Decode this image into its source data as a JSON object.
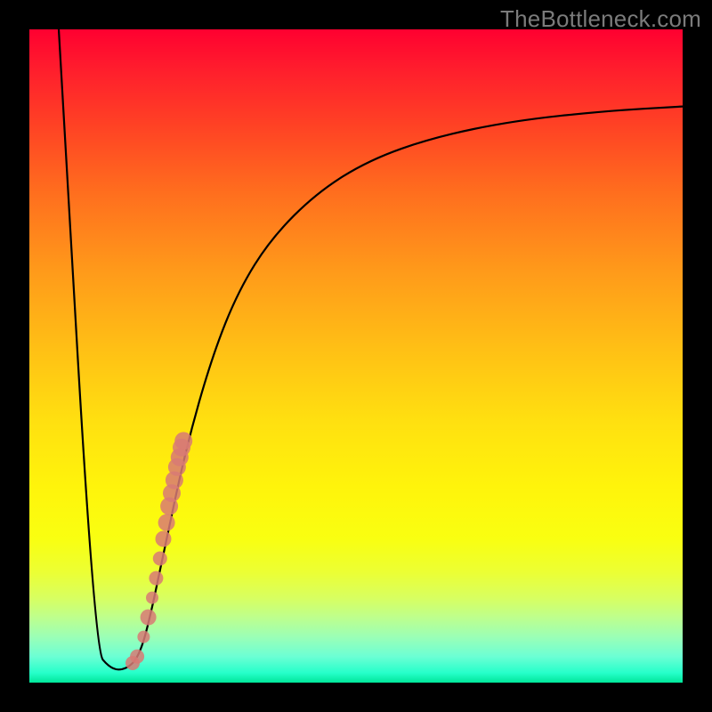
{
  "watermark": "TheBottleneck.com",
  "colors": {
    "frame": "#000000",
    "curve": "#000000",
    "marker_fill": "#d87a74",
    "marker_stroke": "#d87a74"
  },
  "chart_data": {
    "type": "line",
    "title": "",
    "xlabel": "",
    "ylabel": "",
    "xlim": [
      0,
      100
    ],
    "ylim": [
      0,
      100
    ],
    "grid": false,
    "legend": false,
    "series": [
      {
        "name": "bottleneck-curve",
        "kind": "line",
        "x": [
          4.5,
          10.0,
          12.5,
          14.8,
          16.8,
          18.5,
          21.0,
          24.0,
          28.0,
          32.0,
          37.0,
          44.0,
          52.0,
          62.0,
          74.0,
          88.0,
          100.0
        ],
        "y": [
          100.0,
          5.0,
          2.0,
          2.0,
          4.0,
          10.0,
          22.0,
          36.0,
          50.0,
          60.0,
          68.0,
          75.0,
          80.0,
          83.5,
          86.0,
          87.5,
          88.2
        ]
      },
      {
        "name": "highlight-points",
        "kind": "scatter",
        "x": [
          15.8,
          16.5,
          17.5,
          18.2,
          18.8,
          19.4,
          20.0,
          20.5,
          21.0,
          21.4,
          21.8,
          22.2,
          22.6,
          23.0,
          23.3,
          23.6
        ],
        "y": [
          3.0,
          4.0,
          7.0,
          10.0,
          13.0,
          16.0,
          19.0,
          22.0,
          24.5,
          27.0,
          29.0,
          31.0,
          33.0,
          34.5,
          36.0,
          37.0
        ],
        "r": [
          8,
          8,
          7,
          9,
          7,
          8,
          8,
          9,
          9.5,
          10,
          10,
          10,
          10,
          10,
          10,
          10
        ]
      }
    ]
  }
}
